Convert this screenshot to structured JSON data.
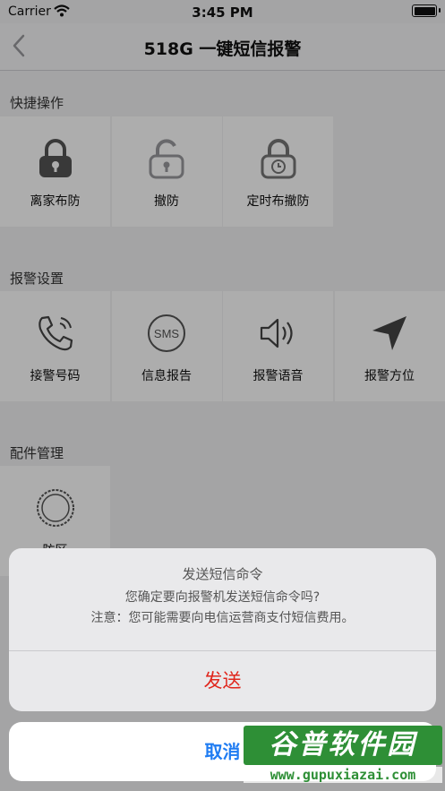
{
  "status": {
    "carrier": "Carrier",
    "time": "3:45 PM"
  },
  "nav": {
    "title": "518G 一键短信报警"
  },
  "sections": {
    "quick": {
      "title": "快捷操作",
      "items": [
        {
          "label": "离家布防",
          "icon": "lock-closed-icon"
        },
        {
          "label": "撤防",
          "icon": "lock-open-icon"
        },
        {
          "label": "定时布撤防",
          "icon": "lock-timer-icon"
        }
      ]
    },
    "alarm": {
      "title": "报警设置",
      "items": [
        {
          "label": "接警号码",
          "icon": "phone-call-icon"
        },
        {
          "label": "信息报告",
          "icon": "sms-icon",
          "icon_text": "SMS"
        },
        {
          "label": "报警语音",
          "icon": "speaker-icon"
        },
        {
          "label": "报警方位",
          "icon": "location-arrow-icon"
        }
      ]
    },
    "accessory": {
      "title": "配件管理",
      "items": [
        {
          "label": "防区",
          "icon": "zone-circle-icon"
        }
      ]
    }
  },
  "alert": {
    "title": "发送短信命令",
    "message_line1": "您确定要向报警机发送短信命令吗?",
    "message_line2": "注意：您可能需要向电信运营商支付短信费用。",
    "send_label": "发送"
  },
  "cancel": {
    "label": "取消"
  },
  "watermark": {
    "text": "谷普软件园",
    "url": "www.gupuxiazai.com"
  },
  "colors": {
    "accent_blue": "#1f7cf2",
    "destructive_red": "#e0261c",
    "watermark_green": "#2e8f36"
  }
}
